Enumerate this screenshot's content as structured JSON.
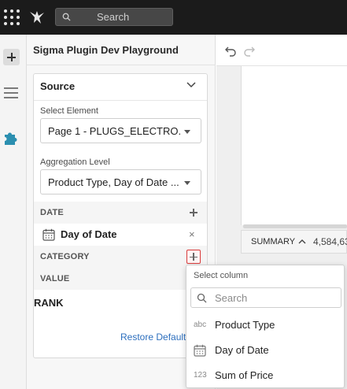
{
  "topbar": {
    "search_placeholder": "Search"
  },
  "panel": {
    "title": "Sigma Plugin Dev Playground",
    "source": {
      "title": "Source",
      "select_element_label": "Select Element",
      "select_element_value": "Page 1 - PLUGS_ELECTRO...",
      "aggregation_label": "Aggregation Level",
      "aggregation_value": "Product Type, Day of Date ..."
    },
    "sections": {
      "date": "DATE",
      "date_column": "Day of Date",
      "date_remove": "×",
      "category": "CATEGORY",
      "value": "VALUE",
      "rank": "RANK"
    },
    "restore_link": "Restore Default V"
  },
  "summary": {
    "label": "SUMMARY",
    "value": "4,584,63"
  },
  "dropdown": {
    "title": "Select column",
    "search_placeholder": "Search",
    "items": [
      {
        "type": "abc",
        "name": "Product Type",
        "icon": "text-type-icon"
      },
      {
        "type": "calendar",
        "name": "Day of Date",
        "icon": "calendar-icon"
      },
      {
        "type": "123",
        "name": "Sum of Price",
        "icon": "number-type-icon"
      }
    ]
  },
  "colors": {
    "topbar": "#1b1b1b",
    "accent_link": "#2d6fbe",
    "active_outline": "#d93a3a"
  }
}
